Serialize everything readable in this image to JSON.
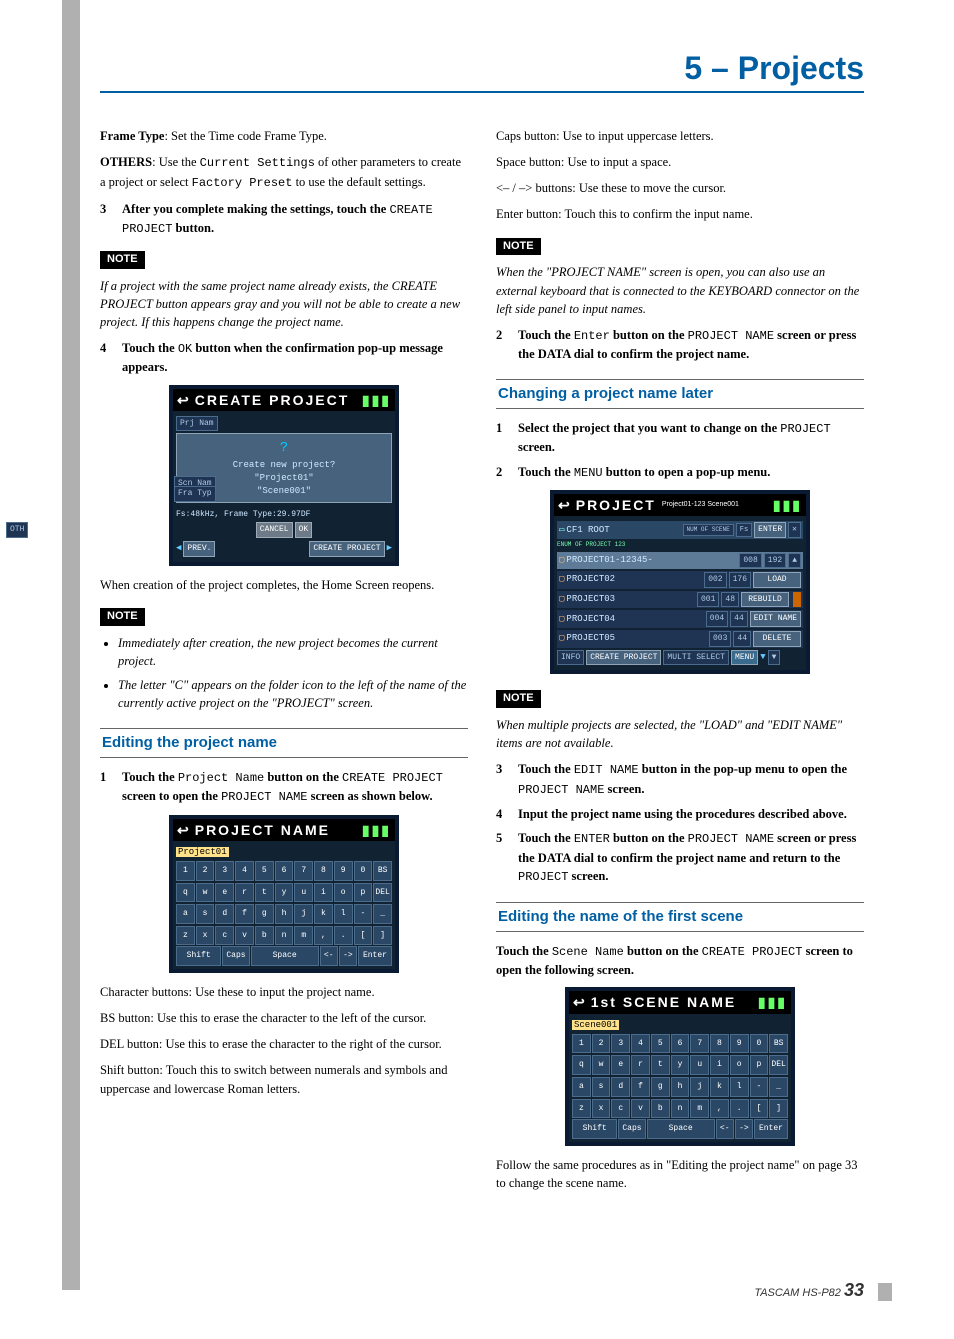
{
  "header": {
    "chapter": "5 – Projects"
  },
  "left": {
    "frame_type_label": "Frame Type",
    "frame_type_text": ": Set the Time code Frame Type.",
    "others_label": "OTHERS",
    "others_text_a": ": Use the ",
    "others_mono1": "Current Settings",
    "others_text_b": " of other parameters to create a project or select ",
    "others_mono2": "Factory Preset",
    "others_text_c": " to use the default settings.",
    "step3_num": "3",
    "step3_text_a": "After you complete making the settings, touch the ",
    "step3_mono": "CREATE PROJECT",
    "step3_text_b": " button.",
    "note1_label": "NOTE",
    "note1_text": "If a project with the same project name already exists, the CREATE PROJECT button appears gray and you will not be able to create a new project. If this happens change the project name.",
    "step4_num": "4",
    "step4_text_a": "Touch the ",
    "step4_mono": "OK",
    "step4_text_b": " button when the confirmation pop-up message appears.",
    "ss_create": {
      "title": "CREATE PROJECT",
      "prj": "Prj Nam",
      "scn": "Scn Nam",
      "fra": "Fra Typ",
      "prompt": "Create new project?",
      "proj": "\"Project01\"",
      "scene": "\"Scene001\"",
      "fs_line": "Fs:48kHz, Frame Type:29.97DF",
      "cancel": "CANCEL",
      "ok": "OK",
      "oth": "OTH",
      "prev": "PREV.",
      "create": "CREATE PROJECT"
    },
    "after_create": "When creation of the project completes, the Home Screen reopens.",
    "note2_label": "NOTE",
    "note2_item1": "Immediately after creation, the new project becomes the current project.",
    "note2_item2": "The letter \"C\" appears on the folder icon to the left of the name of the currently active project on the \"PROJECT\" screen.",
    "section_edit": "Editing the project name",
    "edit_step1_num": "1",
    "edit_step1_a": "Touch the ",
    "edit_step1_m1": "Project Name",
    "edit_step1_b": " button on the ",
    "edit_step1_m2": "CREATE PROJECT",
    "edit_step1_c": " screen to open the ",
    "edit_step1_m3": "PROJECT NAME",
    "edit_step1_d": " screen as shown below.",
    "ss_name": {
      "title": "PROJECT NAME",
      "field": "Project01",
      "row1": [
        "1",
        "2",
        "3",
        "4",
        "5",
        "6",
        "7",
        "8",
        "9",
        "0",
        "BS"
      ],
      "row2": [
        "q",
        "w",
        "e",
        "r",
        "t",
        "y",
        "u",
        "i",
        "o",
        "p",
        "DEL"
      ],
      "row3": [
        "a",
        "s",
        "d",
        "f",
        "g",
        "h",
        "j",
        "k",
        "l",
        "-",
        "_"
      ],
      "row4": [
        "z",
        "x",
        "c",
        "v",
        "b",
        "n",
        "m",
        ",",
        ".",
        "[",
        "]"
      ],
      "shift": "Shift",
      "caps": "Caps",
      "space": "Space",
      "left": "<-",
      "right": "->",
      "enter": "Enter"
    },
    "char_btn": "Character buttons: Use these to input the project name.",
    "bs_btn": "BS button: Use this to erase the character to the left of the cursor.",
    "del_btn": "DEL button: Use this to erase the character to the right of the cursor.",
    "shift_btn": "Shift button: Touch this to switch between numerals and symbols and uppercase and lowercase Roman letters."
  },
  "right": {
    "caps_btn": "Caps button: Use to input uppercase letters.",
    "space_btn": "Space button: Use to input a space.",
    "arrow_btn": "<– / –> buttons: Use these to move the cursor.",
    "enter_btn": "Enter button: Touch this to confirm the input name.",
    "note3_label": "NOTE",
    "note3_text": "When the \"PROJECT NAME\" screen is open, you can also use an external keyboard that is connected to the KEYBOARD connector on the left side panel to input names.",
    "step2_num": "2",
    "step2_a": "Touch the ",
    "step2_m1": "Enter",
    "step2_b": " button on the ",
    "step2_m2": "PROJECT NAME",
    "step2_c": " screen or press the DATA dial to confirm the project name.",
    "section_change": "Changing a project name later",
    "chg_step1_num": "1",
    "chg_step1_a": "Select the project that you want to change on the ",
    "chg_step1_m": "PROJECT",
    "chg_step1_b": " screen.",
    "chg_step2_num": "2",
    "chg_step2_a": "Touch the ",
    "chg_step2_m": "MENU",
    "chg_step2_b": " button to open a pop-up menu.",
    "ss_proj": {
      "title": "PROJECT",
      "sub": "Project01-123 Scene001",
      "path": "CF1 ROOT",
      "path2": "ENUM OF PROJECT 123",
      "hdr_num": "NUM OF SCENE",
      "hdr_fs": "Fs",
      "hdr_enter": "ENTER",
      "rows": [
        {
          "name": "PROJECT01-12345-",
          "n": "008",
          "fs": "192"
        },
        {
          "name": "PROJECT02",
          "n": "002",
          "fs": "176"
        },
        {
          "name": "PROJECT03",
          "n": "001",
          "fs": "48"
        },
        {
          "name": "PROJECT04",
          "n": "004",
          "fs": "44"
        },
        {
          "name": "PROJECT05",
          "n": "003",
          "fs": "44"
        }
      ],
      "menu_items": [
        "LOAD",
        "REBUILD",
        "EDIT NAME",
        "DELETE"
      ],
      "info": "INFO",
      "create": "CREATE PROJECT",
      "multi": "MULTI SELECT",
      "menu": "MENU"
    },
    "note4_label": "NOTE",
    "note4_text": "When multiple projects are selected, the \"LOAD\" and \"EDIT NAME\" items are not available.",
    "chg_step3_num": "3",
    "chg_step3_a": "Touch the ",
    "chg_step3_m1": "EDIT NAME",
    "chg_step3_b": " button in the pop-up menu to open the ",
    "chg_step3_m2": "PROJECT NAME",
    "chg_step3_c": " screen.",
    "chg_step4_num": "4",
    "chg_step4": "Input the project name using the procedures described above.",
    "chg_step5_num": "5",
    "chg_step5_a": "Touch the ",
    "chg_step5_m1": "ENTER",
    "chg_step5_b": " button on the ",
    "chg_step5_m2": "PROJECT NAME",
    "chg_step5_c": " screen or press the DATA dial to confirm the project name and return to the ",
    "chg_step5_m3": "PROJECT",
    "chg_step5_d": " screen.",
    "section_scene": "Editing the name of the first scene",
    "scene_a": "Touch the ",
    "scene_m1": "Scene Name",
    "scene_b": " button on the ",
    "scene_m2": "CREATE PROJECT",
    "scene_c": " screen to open the following screen.",
    "ss_scene": {
      "title": "1st SCENE NAME",
      "field": "Scene001",
      "row1": [
        "1",
        "2",
        "3",
        "4",
        "5",
        "6",
        "7",
        "8",
        "9",
        "0",
        "BS"
      ],
      "row2": [
        "q",
        "w",
        "e",
        "r",
        "t",
        "y",
        "u",
        "i",
        "o",
        "p",
        "DEL"
      ],
      "row3": [
        "a",
        "s",
        "d",
        "f",
        "g",
        "h",
        "j",
        "k",
        "l",
        "-",
        "_"
      ],
      "row4": [
        "z",
        "x",
        "c",
        "v",
        "b",
        "n",
        "m",
        ",",
        ".",
        "[",
        "]"
      ],
      "shift": "Shift",
      "caps": "Caps",
      "space": "Space",
      "left": "<-",
      "right": "->",
      "enter": "Enter"
    },
    "scene_follow": "Follow the same procedures as in \"Editing the project name\" on page 33 to change the scene name."
  },
  "footer": {
    "brand": "TASCAM HS-P82",
    "page": "33"
  }
}
